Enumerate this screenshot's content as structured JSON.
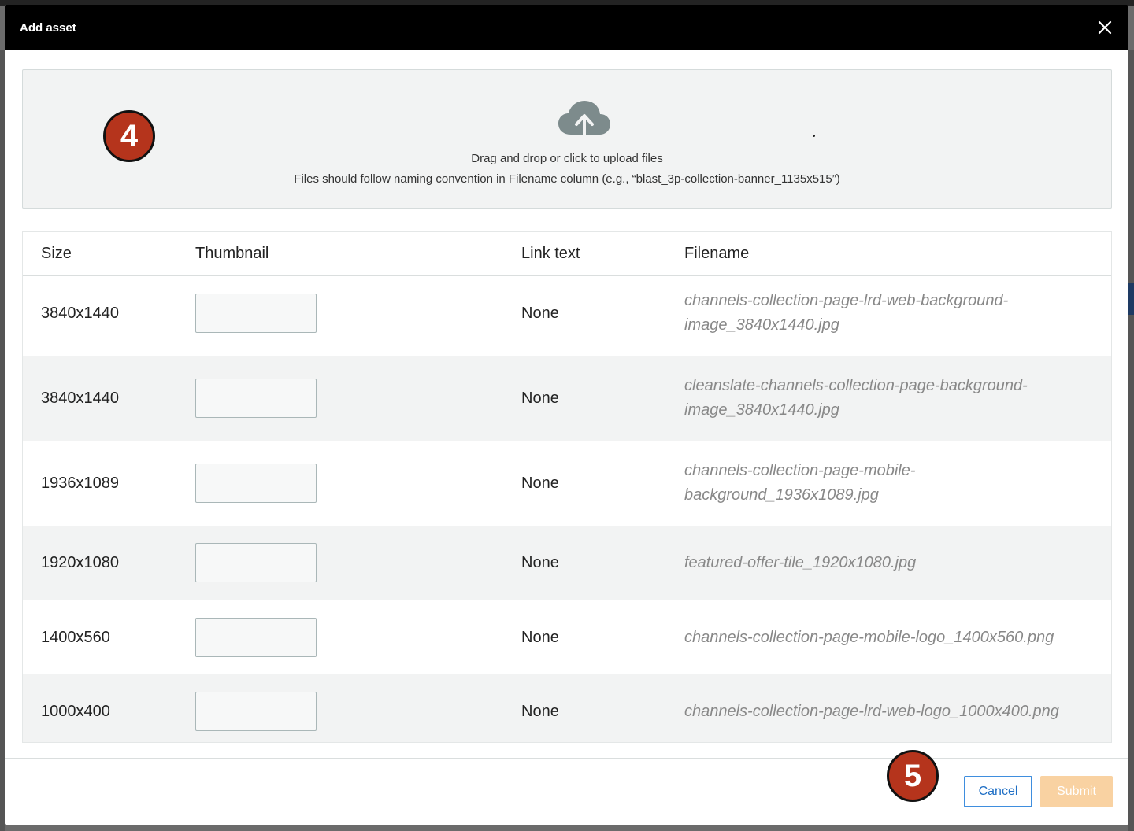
{
  "modal": {
    "title": "Add asset",
    "close_icon": "close-icon"
  },
  "dropzone": {
    "icon": "cloud-upload-icon",
    "line1": "Drag and drop or click to upload files",
    "line2": "Files should follow naming convention in Filename column (e.g., “blast_3p-collection-banner_1135x515”)"
  },
  "badges": {
    "step4": "4",
    "step5": "5"
  },
  "table": {
    "headers": [
      "Size",
      "Thumbnail",
      "Link text",
      "Filename"
    ],
    "rows": [
      {
        "size": "3840x1440",
        "link_text": "None",
        "filename_l1": "channels-collection-page-lrd-web-background-",
        "filename_l2": "image_3840x1440.jpg"
      },
      {
        "size": "3840x1440",
        "link_text": "None",
        "filename_l1": "cleanslate-channels-collection-page-background-",
        "filename_l2": "image_3840x1440.jpg"
      },
      {
        "size": "1936x1089",
        "link_text": "None",
        "filename_l1": "channels-collection-page-mobile-",
        "filename_l2": "background_1936x1089.jpg"
      },
      {
        "size": "1920x1080",
        "link_text": "None",
        "filename_l1": "featured-offer-tile_1920x1080.jpg",
        "filename_l2": ""
      },
      {
        "size": "1400x560",
        "link_text": "None",
        "filename_l1": "channels-collection-page-mobile-logo_1400x560.png",
        "filename_l2": ""
      },
      {
        "size": "1000x400",
        "link_text": "None",
        "filename_l1": "channels-collection-page-lrd-web-logo_1000x400.png",
        "filename_l2": ""
      }
    ]
  },
  "footer": {
    "cancel_label": "Cancel",
    "submit_label": "Submit"
  },
  "colors": {
    "header_bg": "#000000",
    "badge": "#b5341c",
    "cancel_border": "#3f8ede",
    "submit_bg": "#f9d2a2"
  }
}
